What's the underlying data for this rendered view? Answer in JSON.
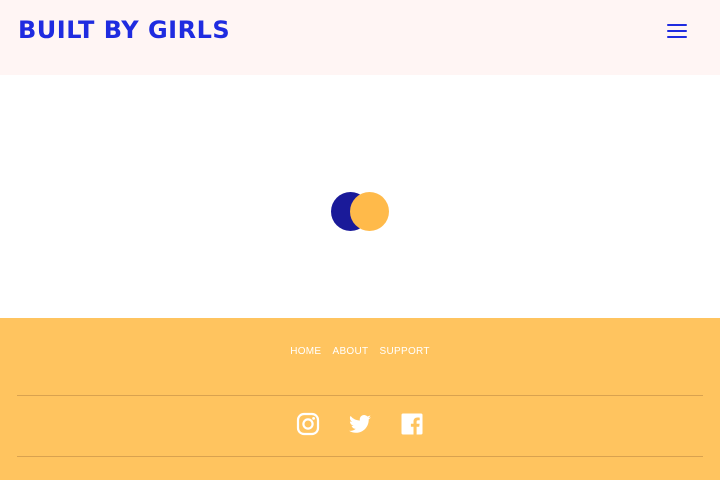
{
  "header": {
    "logo_text": "BUILT BY GIRLS",
    "menu_icon": "hamburger-menu-icon"
  },
  "main": {
    "loader_icon": "loading-spinner-icon"
  },
  "footer": {
    "nav": [
      {
        "label": "HOME"
      },
      {
        "label": "ABOUT"
      },
      {
        "label": "SUPPORT"
      }
    ],
    "social": [
      {
        "icon": "instagram-icon"
      },
      {
        "icon": "twitter-icon"
      },
      {
        "icon": "facebook-icon"
      }
    ]
  },
  "colors": {
    "brand_blue": "#1f2be0",
    "header_bg": "#fff5f4",
    "footer_bg": "#ffc45f",
    "loader_dark": "#1a1a99",
    "loader_light": "#ffba4a"
  }
}
